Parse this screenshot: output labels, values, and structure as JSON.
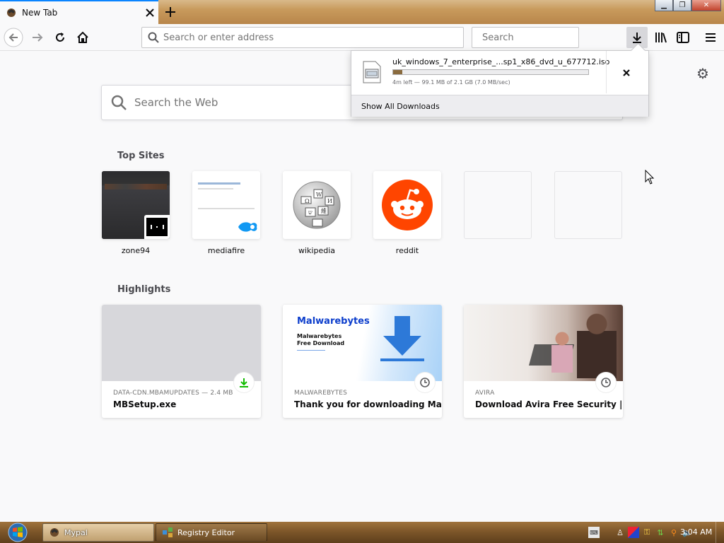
{
  "window": {
    "tab_title": "New Tab",
    "colors": {
      "accent": "#0a84ff",
      "reddit": "#ff4500",
      "download_green": "#12bc00"
    }
  },
  "toolbar": {
    "url_placeholder": "Search or enter address",
    "search_placeholder": "Search"
  },
  "newtab": {
    "search_placeholder": "Search the Web",
    "top_sites_heading": "Top Sites",
    "top_sites": [
      {
        "label": "zone94"
      },
      {
        "label": "mediafire"
      },
      {
        "label": "wikipedia"
      },
      {
        "label": "reddit"
      }
    ],
    "highlights_heading": "Highlights",
    "highlights": [
      {
        "source": "DATA-CDN.MBAMUPDATES — 2.4 MB",
        "title": "MBSetup.exe",
        "badge": "download-icon"
      },
      {
        "source": "MALWAREBYTES",
        "title": "Thank you for downloading Mal...",
        "badge": "clock-icon",
        "thumb": {
          "brand": "Malwarebytes",
          "line1": "Malwarebytes",
          "line2": "Free Download"
        }
      },
      {
        "source": "AVIRA",
        "title": "Download Avira Free Security | ...",
        "badge": "clock-icon"
      }
    ]
  },
  "downloads_panel": {
    "file_name": "uk_windows_7_enterprise_...sp1_x86_dvd_u_677712.iso",
    "status": "4m left — 99.1 MB of 2.1 GB (7.0 MB/sec)",
    "progress": 0.046,
    "show_all": "Show All Downloads"
  },
  "taskbar": {
    "items": [
      {
        "label": "Mypal"
      },
      {
        "label": "Registry Editor"
      }
    ],
    "clock": "3:04 AM"
  }
}
